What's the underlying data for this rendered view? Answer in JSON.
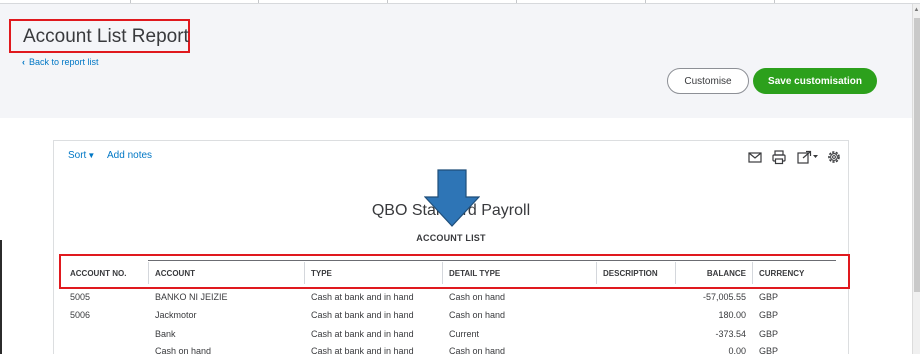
{
  "page": {
    "title": "Account List Report",
    "back_link": "Back to report list",
    "customise_label": "Customise",
    "save_label": "Save customisation"
  },
  "toolbar": {
    "sort_label": "Sort",
    "notes_label": "Add notes",
    "icons": [
      "email-icon",
      "print-icon",
      "export-icon",
      "settings-icon"
    ]
  },
  "report": {
    "company": "QBO Standard Payroll",
    "subtitle": "ACCOUNT LIST",
    "columns": [
      "ACCOUNT NO.",
      "ACCOUNT",
      "TYPE",
      "DETAIL TYPE",
      "DESCRIPTION",
      "BALANCE",
      "CURRENCY"
    ],
    "rows": [
      {
        "no": "5005",
        "account": "BANKO NI JEIZIE",
        "type": "Cash at bank and in hand",
        "detail": "Cash on hand",
        "description": "",
        "balance": "-57,005.55",
        "currency": "GBP"
      },
      {
        "no": "5006",
        "account": "Jackmotor",
        "type": "Cash at bank and in hand",
        "detail": "Cash on hand",
        "description": "",
        "balance": "180.00",
        "currency": "GBP"
      },
      {
        "no": "",
        "account": "Bank",
        "type": "Cash at bank and in hand",
        "detail": "Current",
        "description": "",
        "balance": "-373.54",
        "currency": "GBP"
      },
      {
        "no": "",
        "account": "Cash on hand",
        "type": "Cash at bank and in hand",
        "detail": "Cash on hand",
        "description": "",
        "balance": "0.00",
        "currency": "GBP"
      }
    ]
  },
  "colors": {
    "accent_blue": "#0077c5",
    "save_green": "#2ca01c",
    "highlight_red": "#e0191e",
    "arrow_blue": "#2e75b6"
  }
}
